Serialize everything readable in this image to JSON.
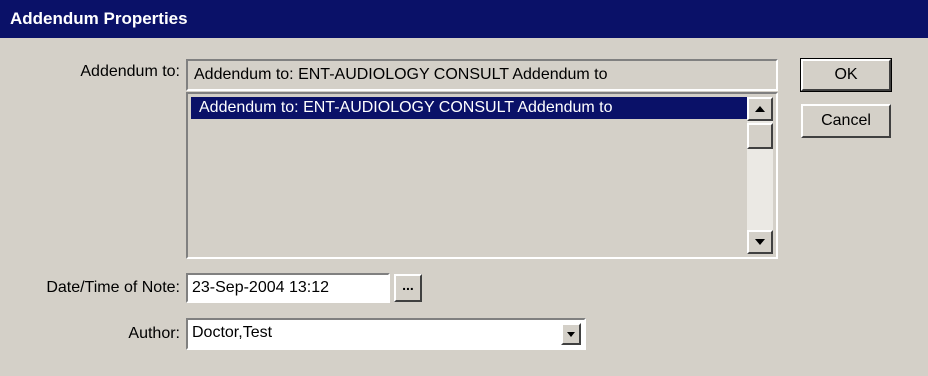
{
  "window": {
    "title": "Addendum Properties"
  },
  "addendum": {
    "label": "Addendum to:",
    "value": "Addendum to: ENT-AUDIOLOGY CONSULT Addendum to",
    "list_items": [
      "Addendum to: ENT-AUDIOLOGY CONSULT Addendum to"
    ]
  },
  "buttons": {
    "ok": "OK",
    "cancel": "Cancel",
    "ellipsis": "..."
  },
  "date_time": {
    "label": "Date/Time of Note:",
    "value": "23-Sep-2004 13:12"
  },
  "author": {
    "label": "Author:",
    "value": "Doctor,Test"
  },
  "icons": {
    "scroll_up": "scroll-up-arrow-icon",
    "scroll_down": "scroll-down-arrow-icon",
    "dropdown": "chevron-down-icon"
  },
  "colors": {
    "titlebar": "#0a1168",
    "face": "#d4d0c8",
    "selection": "#0a1168"
  }
}
